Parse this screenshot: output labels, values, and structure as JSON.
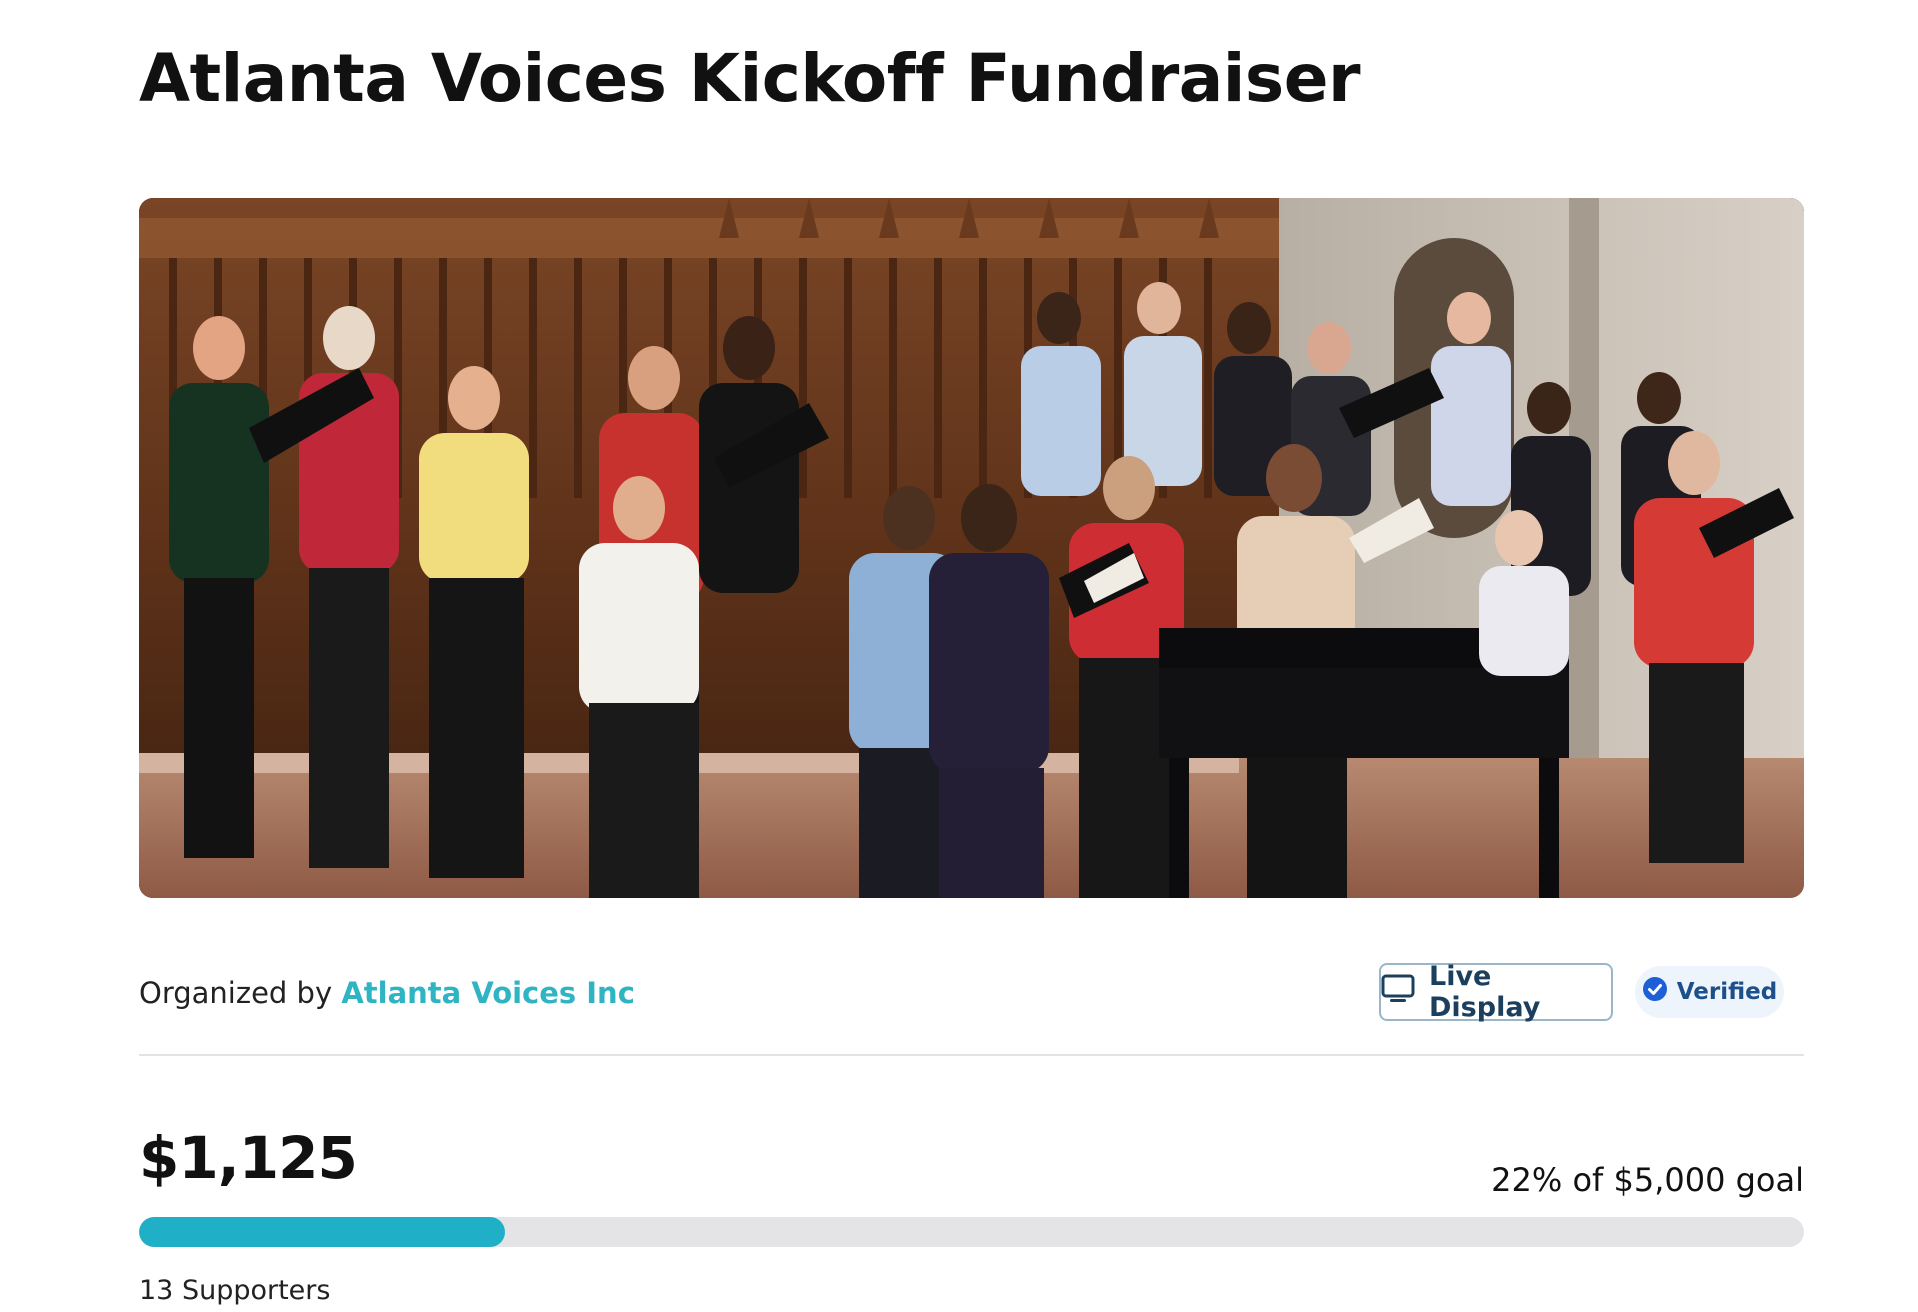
{
  "page": {
    "title": "Atlanta Voices Kickoff Fundraiser"
  },
  "hero_image": {
    "description_icon": "choir-photo"
  },
  "organizer": {
    "prefix": "Organized by",
    "name": "Atlanta Voices Inc",
    "link_color": "#2fb4c4"
  },
  "actions": {
    "live_display_label": "Live Display",
    "live_display_icon": "monitor-icon",
    "verified_label": "Verified",
    "verified_icon": "check-badge-icon"
  },
  "fundraising": {
    "raised": "$1,125",
    "goal_text": "22% of $5,000 goal",
    "progress_fraction": 0.22,
    "progress_color": "#1fb0c8",
    "supporters": "13 Supporters"
  }
}
